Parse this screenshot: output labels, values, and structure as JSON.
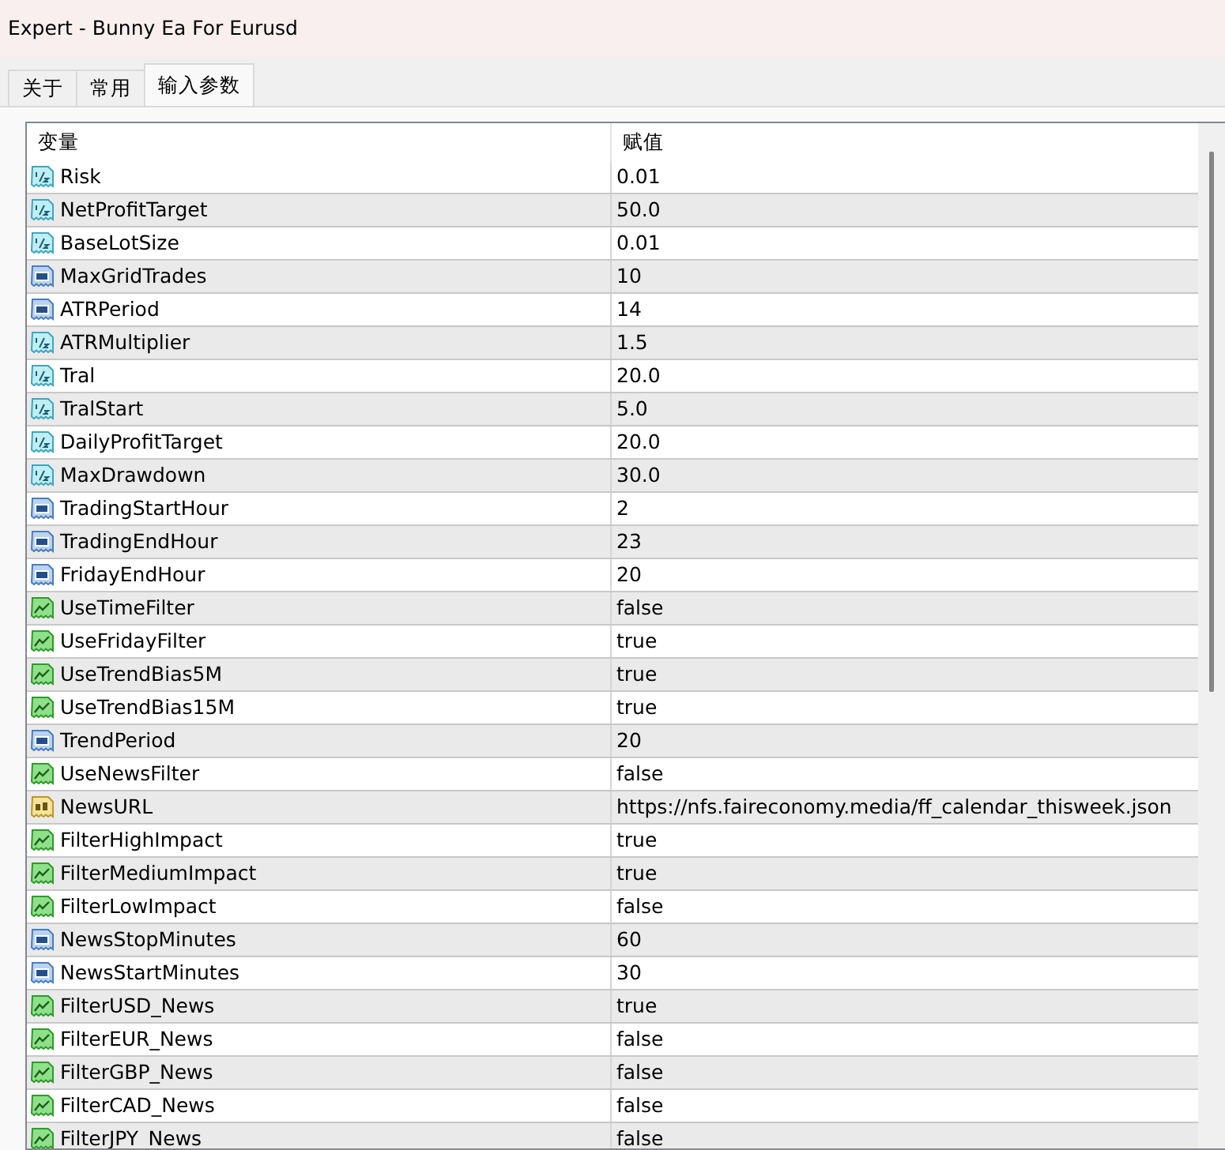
{
  "window": {
    "title": "Expert - Bunny Ea For Eurusd"
  },
  "tabs": [
    {
      "label": "关于",
      "selected": false
    },
    {
      "label": "常用",
      "selected": false
    },
    {
      "label": "输入参数",
      "selected": true
    }
  ],
  "table": {
    "columns": [
      "变量",
      "赋值"
    ],
    "rows": [
      {
        "kind": "double",
        "name": "Risk",
        "value": "0.01"
      },
      {
        "kind": "double",
        "name": "NetProfitTarget",
        "value": "50.0"
      },
      {
        "kind": "double",
        "name": "BaseLotSize",
        "value": "0.01"
      },
      {
        "kind": "int",
        "name": "MaxGridTrades",
        "value": "10"
      },
      {
        "kind": "int",
        "name": "ATRPeriod",
        "value": "14"
      },
      {
        "kind": "double",
        "name": "ATRMultiplier",
        "value": "1.5"
      },
      {
        "kind": "double",
        "name": "Tral",
        "value": "20.0"
      },
      {
        "kind": "double",
        "name": "TralStart",
        "value": "5.0"
      },
      {
        "kind": "double",
        "name": "DailyProfitTarget",
        "value": "20.0"
      },
      {
        "kind": "double",
        "name": "MaxDrawdown",
        "value": "30.0"
      },
      {
        "kind": "int",
        "name": "TradingStartHour",
        "value": "2"
      },
      {
        "kind": "int",
        "name": "TradingEndHour",
        "value": "23"
      },
      {
        "kind": "int",
        "name": "FridayEndHour",
        "value": "20"
      },
      {
        "kind": "bool",
        "name": "UseTimeFilter",
        "value": "false"
      },
      {
        "kind": "bool",
        "name": "UseFridayFilter",
        "value": "true"
      },
      {
        "kind": "bool",
        "name": "UseTrendBias5M",
        "value": "true"
      },
      {
        "kind": "bool",
        "name": "UseTrendBias15M",
        "value": "true"
      },
      {
        "kind": "int",
        "name": "TrendPeriod",
        "value": "20"
      },
      {
        "kind": "bool",
        "name": "UseNewsFilter",
        "value": "false"
      },
      {
        "kind": "string",
        "name": "NewsURL",
        "value": "https://nfs.faireconomy.media/ff_calendar_thisweek.json"
      },
      {
        "kind": "bool",
        "name": "FilterHighImpact",
        "value": "true"
      },
      {
        "kind": "bool",
        "name": "FilterMediumImpact",
        "value": "true"
      },
      {
        "kind": "bool",
        "name": "FilterLowImpact",
        "value": "false"
      },
      {
        "kind": "int",
        "name": "NewsStopMinutes",
        "value": "60"
      },
      {
        "kind": "int",
        "name": "NewsStartMinutes",
        "value": "30"
      },
      {
        "kind": "bool",
        "name": "FilterUSD_News",
        "value": "true"
      },
      {
        "kind": "bool",
        "name": "FilterEUR_News",
        "value": "false"
      },
      {
        "kind": "bool",
        "name": "FilterGBP_News",
        "value": "false"
      },
      {
        "kind": "bool",
        "name": "FilterCAD_News",
        "value": "false"
      },
      {
        "kind": "bool",
        "name": "FilterJPY_News",
        "value": "false"
      }
    ]
  }
}
